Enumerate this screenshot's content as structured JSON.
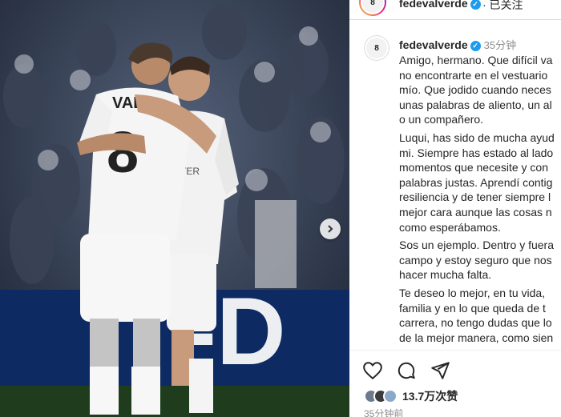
{
  "post": {
    "username": "fedevalverde",
    "follow_status": "· 已关注",
    "time_ago": "35分钟",
    "timestamp": "35分钟前",
    "caption_lines": [
      "Amigo, hermano. Que difícil va",
      "no encontrarte en el vestuario",
      "mío. Que jodido cuando neces",
      "unas palabras de aliento, un al",
      "o un compañero.",
      "Luqui, has sido de mucha ayud",
      "mi. Siempre has estado al lado",
      "momentos que necesite y con",
      "palabras justas. Aprendí contig",
      "resiliencia y de tener siempre l",
      "mejor cara aunque las cosas n",
      "como esperábamos.",
      "Sos un ejemplo. Dentro y fuera",
      "campo y estoy seguro que nos",
      "hacer mucha falta.",
      "Te deseo lo mejor, en tu vida, ",
      "familia y en lo que queda de t",
      "carrera, no tengo dudas que lo",
      "de la mejor manera, como sien"
    ],
    "likes": "13.7万次赞",
    "photo_text": {
      "jersey_name": "VAL",
      "jersey_number": "8",
      "board_text": "-D"
    }
  },
  "icons": {
    "like": "heart-icon",
    "comment": "comment-icon",
    "share": "share-icon",
    "verified": "verified-badge-icon",
    "next": "chevron-right-icon"
  },
  "colors": {
    "verified": "#1d9bf0",
    "pitch": "#1f3d1d",
    "board": "#0e2a63"
  }
}
